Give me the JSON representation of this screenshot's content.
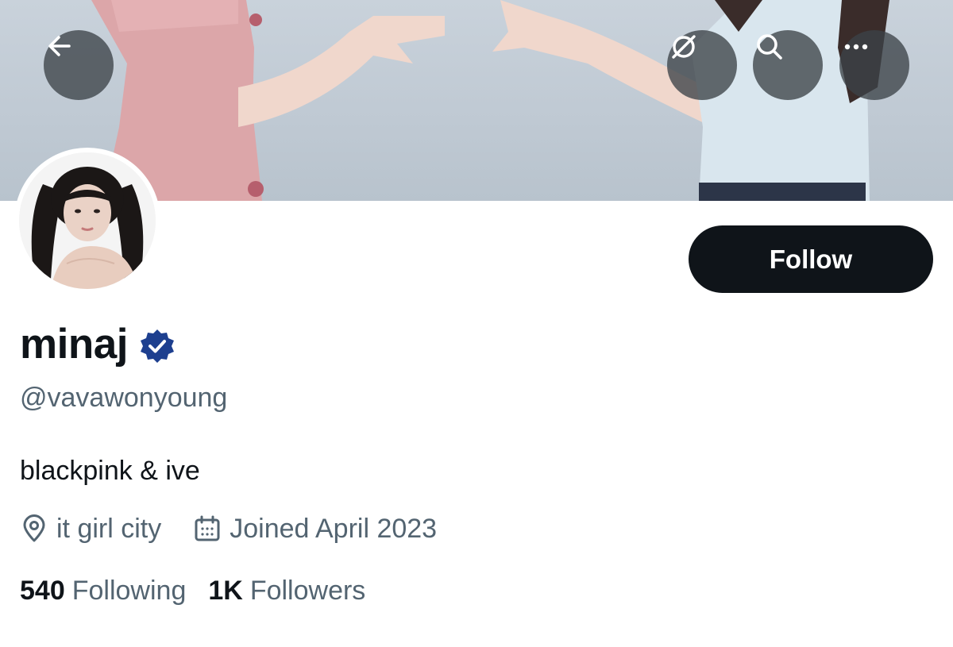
{
  "header": {
    "back_icon": "arrow-left-icon",
    "translate_icon": "slashed-globe-icon",
    "search_icon": "search-icon",
    "more_icon": "more-dots-icon"
  },
  "profile": {
    "display_name": "minaj",
    "handle": "@vavawonyoung",
    "bio": "blackpink & ive",
    "location": "it girl city",
    "joined": "Joined April 2023",
    "following_count": "540",
    "following_label": "Following",
    "followers_count": "1K",
    "followers_label": "Followers"
  },
  "actions": {
    "follow_label": "Follow"
  },
  "colors": {
    "primary_text": "#0f1419",
    "secondary_text": "#536471",
    "follow_button_bg": "#0f1419",
    "verified_badge": "#1d3f8f"
  }
}
